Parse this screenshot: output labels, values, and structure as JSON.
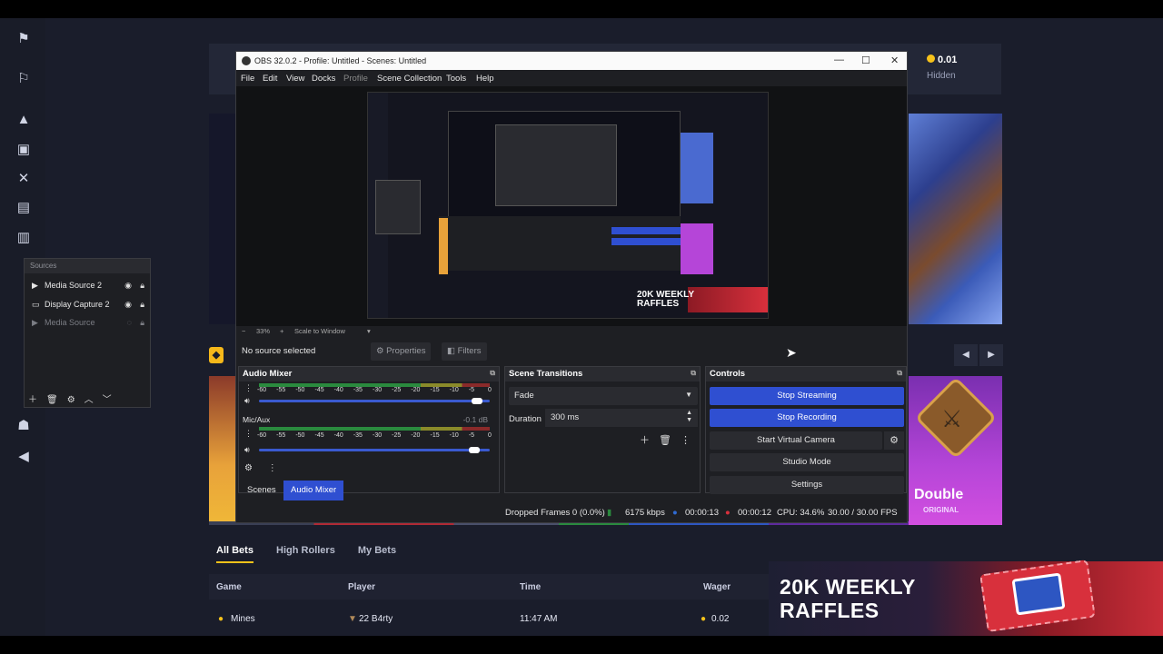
{
  "obs": {
    "title": "OBS 32.0.2 - Profile: Untitled - Scenes: Untitled",
    "menu": [
      "File",
      "Edit",
      "View",
      "Docks",
      "Profile",
      "Scene Collection",
      "Tools",
      "Help"
    ],
    "zoom": "33%",
    "zoom_mode": "Scale to Window",
    "no_source": "No source selected",
    "properties_label": "Properties",
    "filters_label": "Filters",
    "mixer": {
      "title": "Audio Mixer",
      "scale": [
        "-60",
        "-55",
        "-50",
        "-45",
        "-40",
        "-35",
        "-30",
        "-25",
        "-20",
        "-15",
        "-10",
        "-5",
        "0"
      ],
      "channel2_label": "Mic/Aux",
      "channel2_db": "-0.1 dB",
      "channel1_level": 0.96,
      "channel2_level": 0.95
    },
    "transitions": {
      "title": "Scene Transitions",
      "selected": "Fade",
      "duration_label": "Duration",
      "duration_value": "300 ms"
    },
    "controls": {
      "title": "Controls",
      "stop_streaming": "Stop Streaming",
      "stop_recording": "Stop Recording",
      "start_virtual_camera": "Start Virtual Camera",
      "studio_mode": "Studio Mode",
      "settings": "Settings"
    },
    "dock_tabs": {
      "scenes": "Scenes",
      "audio_mixer": "Audio Mixer"
    },
    "status": {
      "dropped": "Dropped Frames 0 (0.0%)",
      "kbps": "6175 kbps",
      "stream_time": "00:00:13",
      "rec_time": "00:00:12",
      "cpu": "CPU: 34.6%",
      "fps": "30.00 / 30.00 FPS"
    },
    "preview": {
      "raffle_line1": "20K WEEKLY",
      "raffle_line2": "RAFFLES"
    }
  },
  "sources": {
    "title": "Sources",
    "items": [
      {
        "label": "Media Source 2"
      },
      {
        "label": "Display Capture 2"
      },
      {
        "label": "Media Source"
      }
    ]
  },
  "site": {
    "balance": "0.01",
    "hidden": "Hidden",
    "card_title": "Double",
    "card_sub": "ORIGINAL",
    "bets_tabs": [
      "All Bets",
      "High Rollers",
      "My Bets"
    ],
    "table_headers": {
      "game": "Game",
      "player": "Player",
      "time": "Time",
      "wager": "Wager"
    },
    "row": {
      "game": "Mines",
      "player": "22  B4rty",
      "time": "11:47 AM",
      "wager": "0.02"
    },
    "raffle_line1": "20K WEEKLY",
    "raffle_line2": "RAFFLES"
  },
  "colors": {
    "accent_blue": "#2f4fd1",
    "coin": "#f6c21a",
    "obs_bg": "#1e1f23"
  }
}
